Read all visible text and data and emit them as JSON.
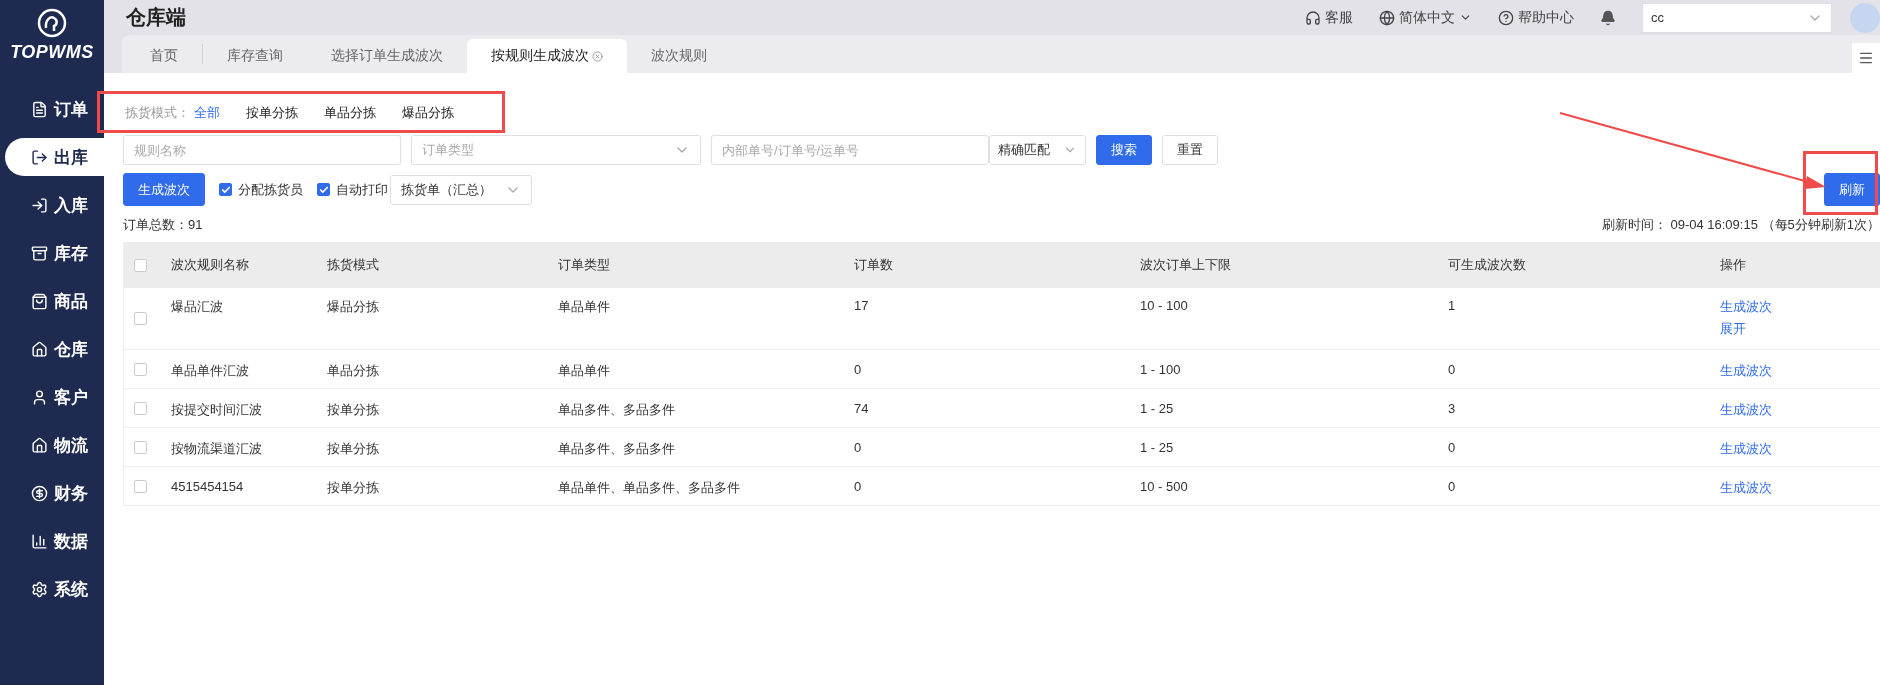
{
  "sidebar": {
    "logo": "TOPWMS",
    "items": [
      {
        "label": "订单",
        "selected": false
      },
      {
        "label": "出库",
        "selected": true
      },
      {
        "label": "入库",
        "selected": false
      },
      {
        "label": "库存",
        "selected": false
      },
      {
        "label": "商品",
        "selected": false
      },
      {
        "label": "仓库",
        "selected": false
      },
      {
        "label": "客户",
        "selected": false
      },
      {
        "label": "物流",
        "selected": false
      },
      {
        "label": "财务",
        "selected": false
      },
      {
        "label": "数据",
        "selected": false
      },
      {
        "label": "系统",
        "selected": false
      }
    ]
  },
  "header": {
    "title": "仓库端",
    "links": [
      "客服",
      "简体中文",
      "帮助中心"
    ],
    "user_select": "cc"
  },
  "tabs": [
    {
      "label": "首页",
      "selected": false
    },
    {
      "label": "库存查询",
      "selected": false
    },
    {
      "label": "选择订单生成波次",
      "selected": false
    },
    {
      "label": "按规则生成波次",
      "selected": true
    },
    {
      "label": "波次规则",
      "selected": false
    }
  ],
  "pick_mode": {
    "label": "拣货模式：",
    "options": [
      {
        "label": "全部",
        "selected": true
      },
      {
        "label": "按单分拣",
        "selected": false
      },
      {
        "label": "单品分拣",
        "selected": false
      },
      {
        "label": "爆品分拣",
        "selected": false
      }
    ]
  },
  "search": {
    "rule_name": {
      "placeholder": "规则名称"
    },
    "order_type": {
      "placeholder": "订单类型"
    },
    "number": {
      "placeholder": "内部单号/订单号/运单号"
    },
    "match": "精确匹配",
    "search_button": "搜索",
    "reset_button": "重置"
  },
  "actions": {
    "generate_button": "生成波次",
    "options": [
      {
        "label": "分配拣货员",
        "checked": true
      },
      {
        "label": "自动打印",
        "checked": true
      }
    ],
    "print_select": "拣货单（汇总）",
    "refresh_button": "刷新"
  },
  "total": "订单总数：91",
  "refresh_time": {
    "label": "刷新时间：",
    "value": "09-04 16:09:15",
    "note": "（每5分钟刷新1次）"
  },
  "table": {
    "all_checked": false,
    "columns": [
      "波次规则名称",
      "拣货模式",
      "订单类型",
      "订单数",
      "波次订单上下限",
      "可生成波次数",
      "操作"
    ],
    "rows": [
      {
        "checked": false,
        "cells": [
          "爆品汇波",
          "爆品分拣",
          "单品单件",
          "17",
          "10 - 100",
          "1"
        ],
        "actions": [
          "生成波次",
          "展开"
        ]
      },
      {
        "checked": false,
        "cells": [
          "单品单件汇波",
          "单品分拣",
          "单品单件",
          "0",
          "1 - 100",
          "0"
        ],
        "actions": [
          "生成波次"
        ]
      },
      {
        "checked": false,
        "cells": [
          "按提交时间汇波",
          "按单分拣",
          "单品多件、多品多件",
          "74",
          "1 - 25",
          "3"
        ],
        "actions": [
          "生成波次"
        ]
      },
      {
        "checked": false,
        "cells": [
          "按物流渠道汇波",
          "按单分拣",
          "单品多件、多品多件",
          "0",
          "1 - 25",
          "0"
        ],
        "actions": [
          "生成波次"
        ]
      },
      {
        "checked": false,
        "cells": [
          "4515454154",
          "按单分拣",
          "单品单件、单品多件、多品多件",
          "0",
          "10 - 500",
          "0"
        ],
        "actions": [
          "生成波次"
        ]
      }
    ]
  }
}
